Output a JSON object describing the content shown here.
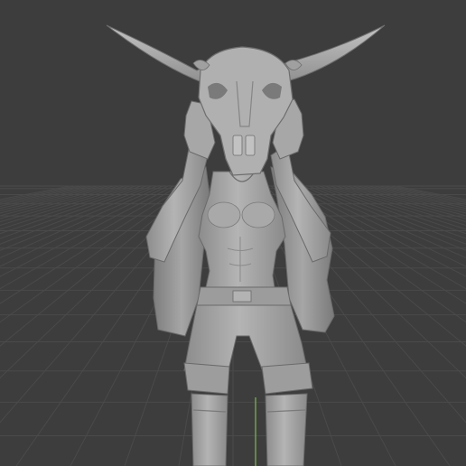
{
  "viewport": {
    "mode": "3D viewport",
    "shading": "solid",
    "model_name": "",
    "show_grid_floor": true,
    "show_z_axis": true
  },
  "colors": {
    "background": "#3d3d3d",
    "grid_line": "#4a4a4a",
    "z_axis": "#6fa24f",
    "model_base": "#a3a3a3",
    "model_shadow": "#6e6e6e",
    "model_highlight": "#c9c9c9"
  },
  "icons": {
    "figure": "sculpted-character-mesh",
    "horns": "horned-skull-mask"
  }
}
